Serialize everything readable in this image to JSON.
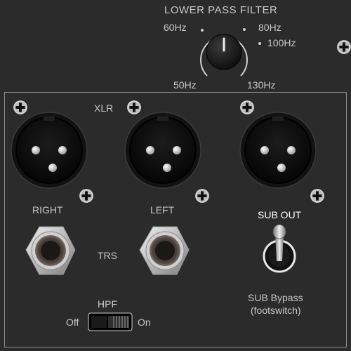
{
  "filter": {
    "title": "LOWER PASS FILTER",
    "labels": [
      "60Hz",
      "80Hz",
      "100Hz",
      "50Hz",
      "130Hz"
    ]
  },
  "inputs": {
    "xlr_label": "XLR",
    "right_label": "RIGHT",
    "left_label": "LEFT",
    "trs_label": "TRS"
  },
  "hpf": {
    "label": "HPF",
    "off_label": "Off",
    "on_label": "On",
    "state": "Off"
  },
  "sub": {
    "out_label": "SUB OUT",
    "bypass_label": "SUB Bypass",
    "footswitch_label": "(footswitch)"
  }
}
